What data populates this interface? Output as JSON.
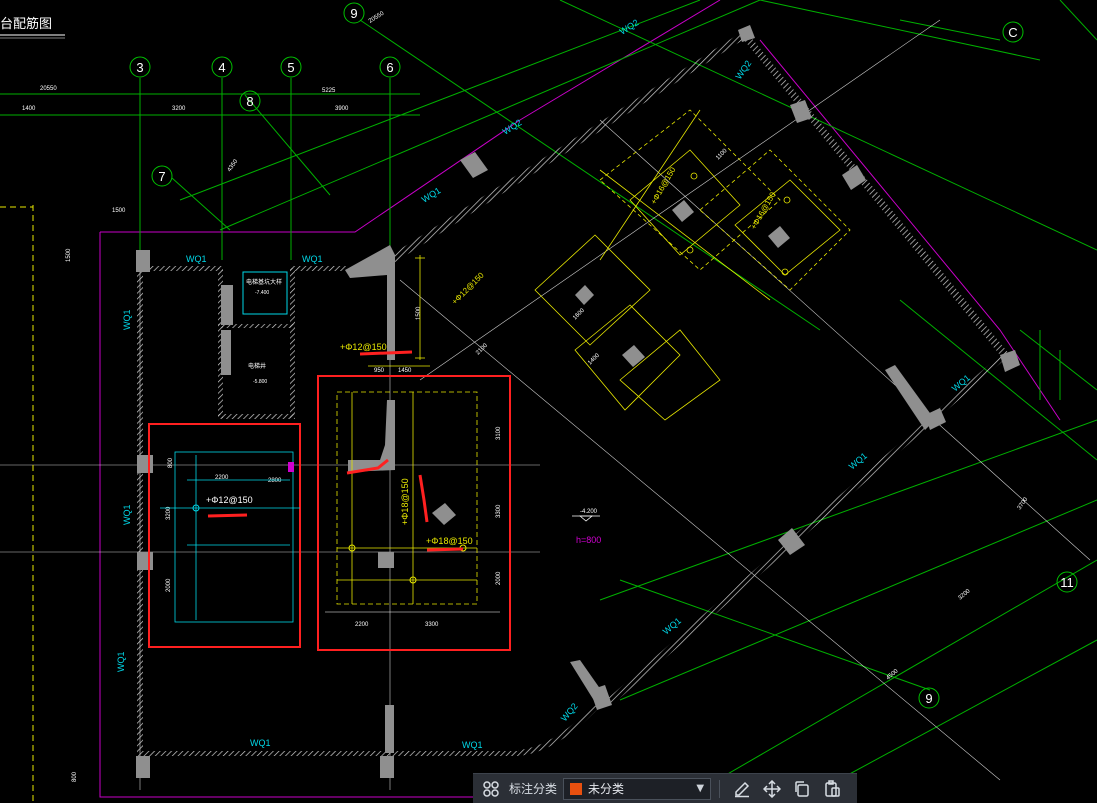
{
  "drawing": {
    "title": "台配筋图",
    "grid_labels": [
      "3",
      "4",
      "5",
      "6",
      "7",
      "8",
      "9",
      "9",
      "11",
      "C"
    ],
    "dimensions": [
      "20550",
      "1400",
      "3200",
      "3900",
      "5225",
      "4350",
      "1500",
      "1500",
      "20550",
      "2100",
      "950",
      "1450",
      "1500",
      "2200",
      "3300",
      "2800",
      "2200",
      "3200",
      "3100",
      "800",
      "3300",
      "3700",
      "2000",
      "2000",
      "3200",
      "1600",
      "1100",
      "1400",
      "4500",
      "800"
    ],
    "wall_tags": [
      "WQ1",
      "WQ1",
      "WQ1",
      "WQ1",
      "WQ1",
      "WQ1",
      "WQ1",
      "WQ1",
      "WQ1",
      "WQ1",
      "WQ1",
      "WQ2",
      "WQ2",
      "WQ2",
      "WQ2"
    ],
    "rebar_labels": [
      "+Φ12@150",
      "+Φ12@150",
      "+Φ18@150",
      "+Φ18@150",
      "+Φ12@150",
      "+Φ16@150",
      "+Φ16@150"
    ],
    "room_labels": [
      "电梯基坑大样",
      "-7.400",
      "电梯井",
      "-5.800"
    ],
    "elevation_note": "-4.200",
    "thickness_note": "h=800"
  },
  "toolbar": {
    "category_label": "标注分类",
    "category_value": "未分类",
    "category_color": "#e8500f",
    "icons": [
      "grid-icon",
      "edit-icon",
      "move-icon",
      "copy-icon",
      "paste-icon"
    ]
  },
  "colors": {
    "grid_line": "#00c000",
    "wall": "#ffffff",
    "hatch": "#bbbbbb",
    "column": "#9a9a9a",
    "magenta": "#d000d0",
    "cyan": "#00d8e8",
    "yellow": "#e8e800",
    "highlight": "#ff2020"
  }
}
